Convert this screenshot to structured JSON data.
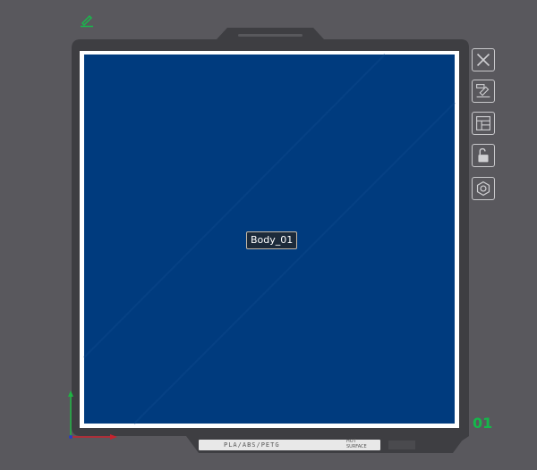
{
  "object": {
    "name": "Body_01"
  },
  "plate": {
    "number": "01",
    "filament_text": "PLA/ABS/PETG",
    "warning_text": "HOT SURFACE"
  },
  "toolbar": {
    "buttons": [
      {
        "name": "close-icon"
      },
      {
        "name": "edit-plate-icon"
      },
      {
        "name": "layout-icon"
      },
      {
        "name": "unlock-icon"
      },
      {
        "name": "settings-icon"
      }
    ]
  },
  "colors": {
    "background": "#59585d",
    "plate_blue": "#003b7e",
    "plate_frame": "#3e3e42",
    "accent_green": "#14b84a"
  }
}
